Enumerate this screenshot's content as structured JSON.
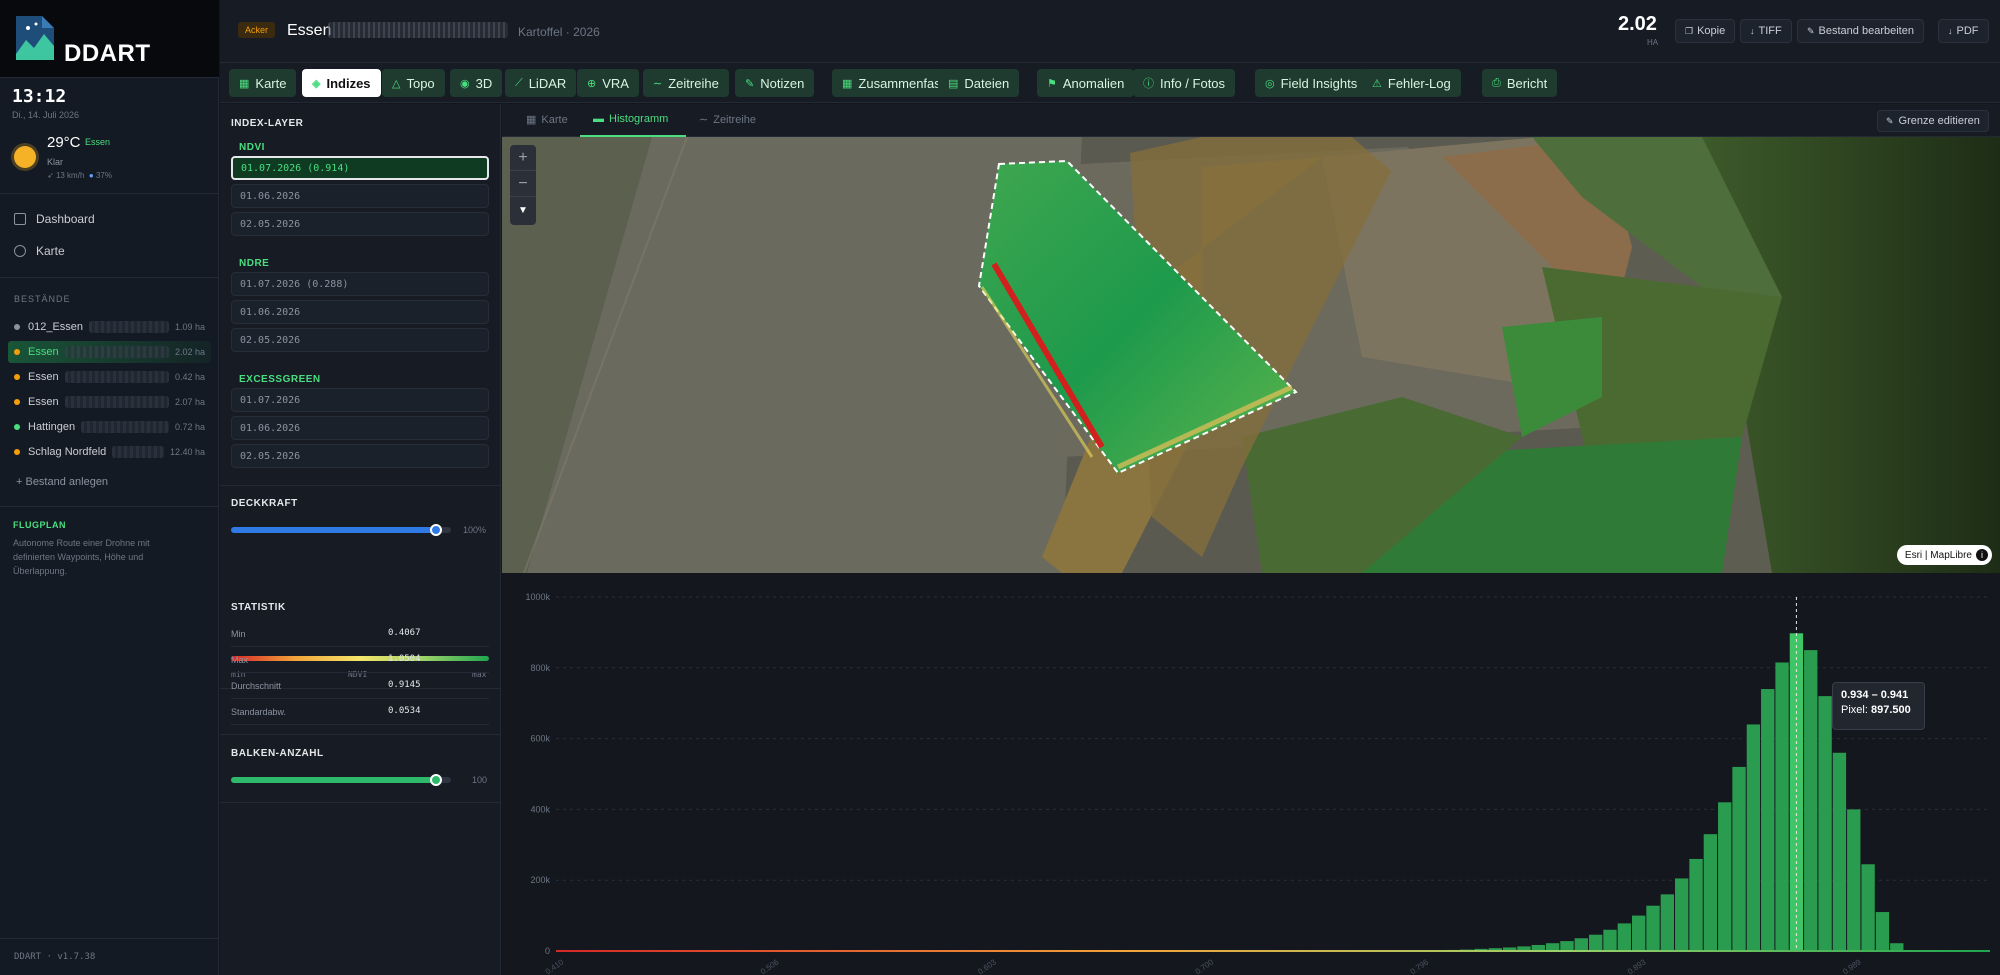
{
  "app": {
    "name": "DDART",
    "version": "DDART · v1.7.38"
  },
  "sidebar": {
    "clock": "13:12",
    "date": "Di., 14. Juli 2026",
    "weather": {
      "temp": "29°C",
      "city": "Essen",
      "condition": "Klar",
      "wind": "13 km/h",
      "humidity": "37%"
    },
    "nav": [
      {
        "label": "Dashboard",
        "icon": "grid-icon"
      },
      {
        "label": "Karte",
        "icon": "globe-icon"
      }
    ],
    "section_title": "BESTÄNDE",
    "stands": [
      {
        "name": "012_Essen",
        "ha": "1.09 ha",
        "color": "#8b93a1"
      },
      {
        "name": "Essen",
        "ha": "2.02 ha",
        "color": "#f59e0b",
        "active": true
      },
      {
        "name": "Essen",
        "ha": "0.42 ha",
        "color": "#f59e0b"
      },
      {
        "name": "Essen",
        "ha": "2.07 ha",
        "color": "#f59e0b"
      },
      {
        "name": "Hattingen",
        "ha": "0.72 ha",
        "color": "#4ade80"
      },
      {
        "name": "Schlag Nordfeld",
        "ha": "12.40 ha",
        "color": "#f59e0b"
      }
    ],
    "add_stand": "+ Bestand anlegen",
    "flugplan": {
      "title": "FLUGPLAN",
      "text": "Autonome Route einer Drohne mit definierten Waypoints, Höhe und Überlappung."
    }
  },
  "header": {
    "badge": "Acker",
    "title": "Essen",
    "crop": "Kartoffel · 2026",
    "area_value": "2.02",
    "area_unit": "HA",
    "buttons": [
      {
        "label": "Kopie",
        "icon": "copy-icon"
      },
      {
        "label": "TIFF",
        "icon": "download-icon"
      },
      {
        "label": "Bestand bearbeiten",
        "icon": "pencil-icon"
      },
      {
        "label": "PDF",
        "icon": "download-icon"
      }
    ]
  },
  "tabs": [
    {
      "label": "Karte",
      "icon": "▦"
    },
    {
      "label": "Indizes",
      "icon": "◈",
      "active": true
    },
    {
      "label": "Topo",
      "icon": "△"
    },
    {
      "label": "3D",
      "icon": "◉"
    },
    {
      "label": "LiDAR",
      "icon": "⟋"
    },
    {
      "label": "VRA",
      "icon": "⊕"
    },
    {
      "label": "Zeitreihe",
      "icon": "∼"
    },
    {
      "label": "Notizen",
      "icon": "✎"
    },
    {
      "label": "Zusammenfassung",
      "icon": "▦"
    },
    {
      "label": "Dateien",
      "icon": "▤"
    },
    {
      "label": "Anomalien",
      "icon": "⚑"
    },
    {
      "label": "Info / Fotos",
      "icon": "ⓘ"
    },
    {
      "label": "Field Insights",
      "icon": "◎"
    },
    {
      "label": "Fehler-Log",
      "icon": "⚠"
    },
    {
      "label": "Bericht",
      "icon": "⎙"
    }
  ],
  "index_panel": {
    "title": "INDEX-LAYER",
    "groups": [
      {
        "name": "NDVI",
        "items": [
          "01.07.2026 (0.914)",
          "01.06.2026",
          "02.05.2026"
        ]
      },
      {
        "name": "NDRE",
        "items": [
          "01.07.2026 (0.288)",
          "01.06.2026",
          "02.05.2026"
        ]
      },
      {
        "name": "EXCESSGREEN",
        "items": [
          "01.07.2026",
          "01.06.2026",
          "02.05.2026"
        ]
      }
    ],
    "opacity": {
      "title": "DECKKRAFT",
      "value": "100%",
      "fraction": 0.93,
      "legend_min": "min",
      "legend_mid": "NDVI",
      "legend_max": "max"
    },
    "stats": {
      "title": "STATISTIK",
      "rows": [
        {
          "label": "Min",
          "value": "0.4067"
        },
        {
          "label": "Max",
          "value": "1.0504"
        },
        {
          "label": "Durchschnitt",
          "value": "0.9145"
        },
        {
          "label": "Standardabw.",
          "value": "0.0534"
        }
      ]
    },
    "bins": {
      "title": "BALKEN-ANZAHL",
      "value": "100",
      "fraction": 0.93
    }
  },
  "subtabs": [
    {
      "label": "Karte",
      "icon": "▦"
    },
    {
      "label": "Histogramm",
      "icon": "▬",
      "active": true
    },
    {
      "label": "Zeitreihe",
      "icon": "∼"
    }
  ],
  "edit_border": "Grenze editieren",
  "map": {
    "attribution": "Esri | MapLibre",
    "zoom_in": "+",
    "zoom_out": "−",
    "compass": "▼"
  },
  "chart_data": {
    "type": "bar",
    "title": "",
    "xlabel": "",
    "ylabel": "",
    "ylim": [
      0,
      1000000
    ],
    "yticks": [
      "0",
      "200k",
      "400k",
      "600k",
      "800k",
      "1000k"
    ],
    "xticks": [
      "0.410",
      "0.506",
      "0.603",
      "0.700",
      "0.796",
      "0.893",
      "0.989"
    ],
    "xlim": [
      0.41,
      1.05
    ],
    "bin_width": 0.0064,
    "bin_start": 0.41,
    "bar_color": "#2a9c4f",
    "highlight_color": "#3fc566",
    "values": [
      0,
      0,
      0,
      0,
      0,
      0,
      0,
      0,
      0,
      0,
      0,
      0,
      0,
      0,
      0,
      0,
      0,
      0,
      0,
      0,
      0,
      0,
      0,
      0,
      0,
      0,
      0,
      0,
      0,
      0,
      0,
      0,
      0,
      0,
      0,
      0,
      0,
      0,
      0,
      0,
      0,
      0,
      0,
      0,
      0,
      0,
      0,
      0,
      0,
      0,
      0,
      0,
      0,
      0,
      0,
      0,
      0,
      0,
      0,
      0,
      1000,
      2000,
      3000,
      4000,
      6000,
      8000,
      10000,
      13000,
      17000,
      22000,
      28000,
      36000,
      46000,
      60000,
      78000,
      100000,
      128000,
      160000,
      205000,
      260000,
      330000,
      420000,
      520000,
      640000,
      740000,
      815000,
      897500,
      850000,
      720000,
      560000,
      400000,
      245000,
      110000,
      22000,
      2000,
      0,
      0,
      0,
      0,
      0
    ],
    "highlight_index": 86,
    "tooltip": {
      "range": "0.934 – 0.941",
      "pixel_label": "Pixel:",
      "pixel_value": "897.500"
    }
  }
}
